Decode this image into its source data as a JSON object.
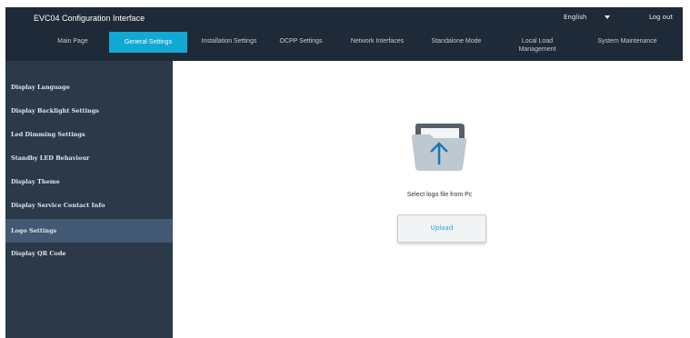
{
  "header": {
    "title": "EVC04 Configuration Interface",
    "language": "English",
    "logout_label": "Log out"
  },
  "nav": {
    "tabs": [
      {
        "label": "Main Page"
      },
      {
        "label": "General Settings",
        "active": true
      },
      {
        "label": "Installation Settings"
      },
      {
        "label": "OCPP Settings"
      },
      {
        "label": "Network Interfaces"
      },
      {
        "label": "Standalone Mode"
      },
      {
        "label": "Local Load Management"
      },
      {
        "label": "System Maintenance"
      }
    ]
  },
  "sidebar": {
    "items": [
      {
        "label": "Display Language"
      },
      {
        "label": "Display Backlight Settings"
      },
      {
        "label": "Led Dimming Settings"
      },
      {
        "label": "Standby LED Behaviour"
      },
      {
        "label": "Display Theme"
      },
      {
        "label": "Display Service Contact Info"
      },
      {
        "label": "Logo Settings",
        "active": true
      },
      {
        "label": "Display QR Code"
      }
    ]
  },
  "main": {
    "select_label": "Select logo file from Pc",
    "upload_label": "Upload",
    "icon": "folder-upload-icon"
  },
  "colors": {
    "header_bg": "#1e2a38",
    "accent": "#11a9d3",
    "sidebar_bg": "#2b3949",
    "sidebar_active_bg": "#435872",
    "upload_text": "#11a9d3"
  }
}
